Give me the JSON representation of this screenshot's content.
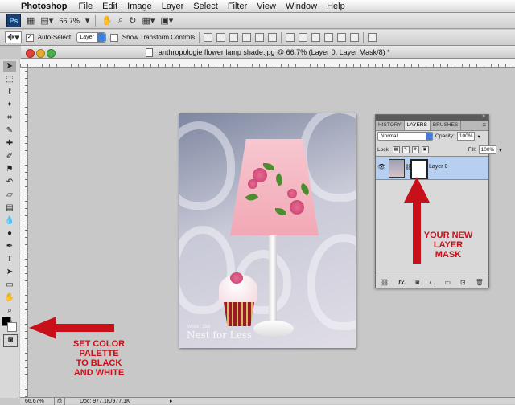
{
  "menubar": {
    "app_name": "Photoshop",
    "items": [
      "File",
      "Edit",
      "Image",
      "Layer",
      "Select",
      "Filter",
      "View",
      "Window",
      "Help"
    ]
  },
  "appbar": {
    "logo": "Ps",
    "zoom": "66.7%"
  },
  "options": {
    "auto_select_label": "Auto-Select:",
    "auto_select_value": "Layer",
    "transform_label": "Show Transform Controls"
  },
  "document": {
    "title": "anthropologie flower lamp shade.jpg @ 66.7% (Layer 0, Layer Mask/8) *"
  },
  "canvas": {
    "watermark_small": "sweet the",
    "watermark": "Nest for Less"
  },
  "layers_panel": {
    "tabs": [
      "HISTORY",
      "LAYERS",
      "BRUSHES"
    ],
    "blend_mode": "Normal",
    "opacity_label": "Opacity:",
    "opacity_value": "100%",
    "lock_label": "Lock:",
    "fill_label": "Fill:",
    "fill_value": "100%",
    "layer_name": "Layer 0",
    "footer_icons": [
      "link-icon",
      "fx-icon",
      "mask-icon",
      "adjustment-icon",
      "group-icon",
      "new-layer-icon",
      "trash-icon"
    ]
  },
  "annotations": {
    "layer_mask_note": [
      "YOUR NEW",
      "LAYER",
      "MASK"
    ],
    "color_palette_note": [
      "SET COLOR",
      "PALETTE",
      "TO BLACK",
      "AND WHITE"
    ]
  },
  "status": {
    "zoom": "66.67%",
    "doc": "Doc: 977.1K/977.1K"
  },
  "colors": {
    "annotation_red": "#c8101a",
    "selected_layer": "#b7cff0",
    "ps_blue": "#1b3f73"
  }
}
